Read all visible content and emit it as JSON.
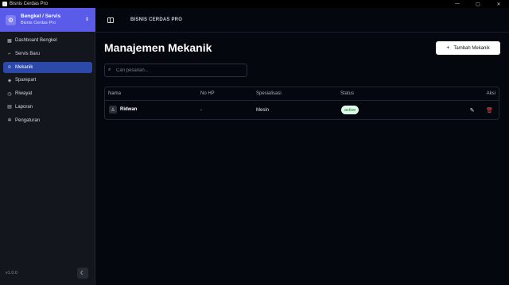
{
  "window": {
    "title": "Bisnis Cerdas Pro",
    "minimize": "—",
    "maximize": "▢",
    "close": "✕"
  },
  "brand": {
    "title": "Bengkel / Servis",
    "subtitle": "Bisnis Cerdas Pro",
    "logo_icon": "⚙",
    "chevron": "⇕"
  },
  "sidebar": {
    "items": [
      {
        "label": "Dashboard Bengkel",
        "icon": "▦",
        "icon_name": "dashboard-icon"
      },
      {
        "label": "Servis Baru",
        "icon": "⌐",
        "icon_name": "wrench-icon"
      },
      {
        "label": "Mekanik",
        "icon": "☺",
        "icon_name": "users-icon",
        "active": true
      },
      {
        "label": "Sparepart",
        "icon": "◈",
        "icon_name": "box-icon"
      },
      {
        "label": "Riwayat",
        "icon": "◷",
        "icon_name": "history-icon"
      },
      {
        "label": "Laporan",
        "icon": "▤",
        "icon_name": "report-icon"
      },
      {
        "label": "Pengaturan",
        "icon": "✲",
        "icon_name": "gear-icon"
      }
    ],
    "version": "v1.0.0",
    "theme_icon": "☾"
  },
  "topbar": {
    "title": "BISNIS CERDAS PRO"
  },
  "main": {
    "title": "Manajemen Mekanik",
    "add_button": {
      "label": "Tambah Mekanik",
      "icon": "+"
    },
    "search": {
      "placeholder": "Cari pesanan...",
      "value": "",
      "icon": "⌕"
    },
    "table": {
      "headers": {
        "name": "Nama",
        "phone": "No HP",
        "specialization": "Spesialisasi",
        "status": "Status",
        "actions": "Aksi"
      },
      "rows": [
        {
          "name": "Ridwan",
          "phone": "-",
          "specialization": "Mesin",
          "status": "active",
          "avatar_icon": "♙",
          "edit_icon": "✎",
          "delete_icon": "🗑"
        }
      ]
    }
  },
  "colors": {
    "accent": "#5b5bea",
    "active_nav": "#2c48a8",
    "status_active_bg": "#dcfce7",
    "status_active_fg": "#15803d",
    "danger": "#ef4444"
  }
}
